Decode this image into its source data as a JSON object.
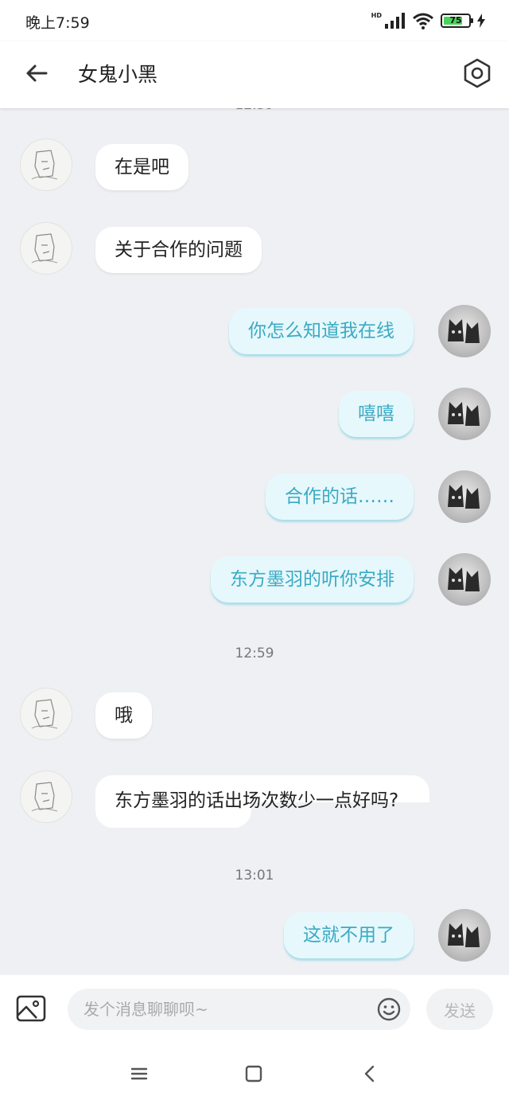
{
  "status_bar": {
    "time": "晚上7:59",
    "network_label": "HD",
    "battery_level": "75"
  },
  "header": {
    "title": "女鬼小黑"
  },
  "timestamps": [
    "12:59",
    "13:01"
  ],
  "messages": [
    {
      "side": "left",
      "text": "在是吧"
    },
    {
      "side": "left",
      "text": "关于合作的问题"
    },
    {
      "side": "right",
      "text": "你怎么知道我在线"
    },
    {
      "side": "right",
      "text": "嘻嘻"
    },
    {
      "side": "right",
      "text": "合作的话……"
    },
    {
      "side": "right",
      "text": "东方墨羽的听你安排"
    },
    {
      "side": "left",
      "text": "哦"
    },
    {
      "side": "left",
      "text": "东方墨羽的话出场次数少一点好吗?"
    },
    {
      "side": "right",
      "text": "这就不用了"
    }
  ],
  "input": {
    "placeholder": "发个消息聊聊呗~",
    "value": ""
  },
  "send_label": "发送",
  "colors": {
    "accent_text": "#3aaac4",
    "right_bubble": "#e6f8fc",
    "background": "#eef0f3"
  },
  "icons": [
    "back-arrow-icon",
    "settings-icon",
    "image-icon",
    "emoji-icon",
    "menu-icon",
    "home-icon",
    "back-icon"
  ]
}
